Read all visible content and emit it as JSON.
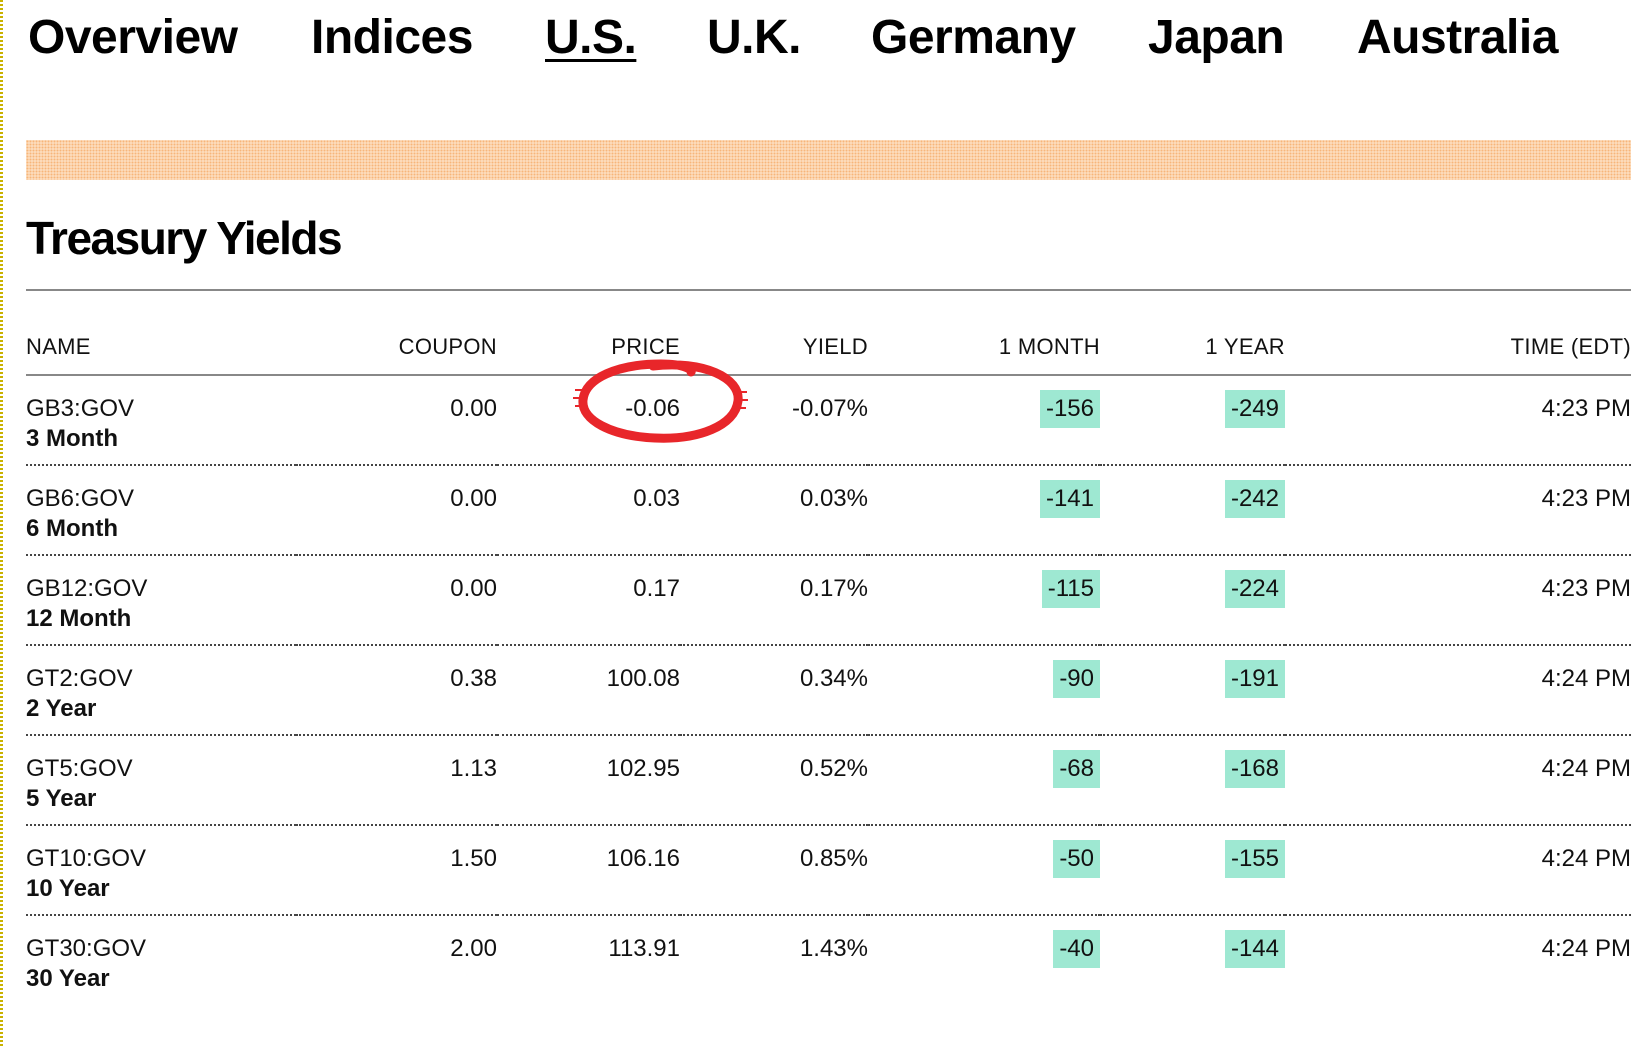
{
  "nav": {
    "items": [
      {
        "label": "Overview"
      },
      {
        "label": "Indices"
      },
      {
        "label": "U.S."
      },
      {
        "label": "U.K."
      },
      {
        "label": "Germany"
      },
      {
        "label": "Japan"
      },
      {
        "label": "Australia"
      }
    ],
    "active": "U.S."
  },
  "section": {
    "title": "Treasury Yields"
  },
  "table": {
    "columns": [
      "NAME",
      "COUPON",
      "PRICE",
      "YIELD",
      "1 MONTH",
      "1 YEAR",
      "TIME (EDT)"
    ],
    "rows": [
      {
        "symbol": "GB3:GOV",
        "term": "3 Month",
        "coupon": "0.00",
        "price": "-0.06",
        "yield": "-0.07%",
        "month": "-156",
        "year": "-249",
        "time": "4:23 PM"
      },
      {
        "symbol": "GB6:GOV",
        "term": "6 Month",
        "coupon": "0.00",
        "price": "0.03",
        "yield": "0.03%",
        "month": "-141",
        "year": "-242",
        "time": "4:23 PM"
      },
      {
        "symbol": "GB12:GOV",
        "term": "12 Month",
        "coupon": "0.00",
        "price": "0.17",
        "yield": "0.17%",
        "month": "-115",
        "year": "-224",
        "time": "4:23 PM"
      },
      {
        "symbol": "GT2:GOV",
        "term": "2 Year",
        "coupon": "0.38",
        "price": "100.08",
        "yield": "0.34%",
        "month": "-90",
        "year": "-191",
        "time": "4:24 PM"
      },
      {
        "symbol": "GT5:GOV",
        "term": "5 Year",
        "coupon": "1.13",
        "price": "102.95",
        "yield": "0.52%",
        "month": "-68",
        "year": "-168",
        "time": "4:24 PM"
      },
      {
        "symbol": "GT10:GOV",
        "term": "10 Year",
        "coupon": "1.50",
        "price": "106.16",
        "yield": "0.85%",
        "month": "-50",
        "year": "-155",
        "time": "4:24 PM"
      },
      {
        "symbol": "GT30:GOV",
        "term": "30 Year",
        "coupon": "2.00",
        "price": "113.91",
        "yield": "1.43%",
        "month": "-40",
        "year": "-144",
        "time": "4:24 PM"
      }
    ]
  },
  "colors": {
    "change_badge_bg": "#9ee8d2",
    "annotation_circle": "#e8262a",
    "ad_banner": "#fde2c6"
  }
}
